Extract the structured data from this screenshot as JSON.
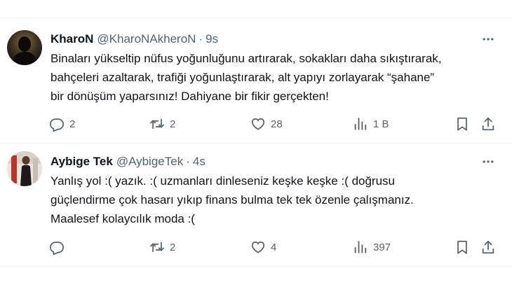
{
  "tweets": [
    {
      "author": {
        "name": "KharoN",
        "handle": "@KharoNAkheroN",
        "avatar": "dark-silhouette-avatar"
      },
      "separator": "·",
      "time": "9s",
      "text_lines": [
        "Binaları yükseltip nüfus yoğunluğunu artırarak, sokakları daha sıkıştırarak,",
        "bahçeleri azaltarak, trafiği yoğunlaştırarak, alt yapıyı zorlayarak “şahane”",
        "bir dönüşüm yaparsınız! Dahiyane bir fikir gerçekten!"
      ],
      "actions": {
        "replies": "2",
        "retweets": "2",
        "likes": "28",
        "views": "1 B"
      }
    },
    {
      "author": {
        "name": "Aybige Tek",
        "handle": "@AybigeTek",
        "avatar": "photo-avatar"
      },
      "separator": "·",
      "time": "4s",
      "text_lines": [
        "Yanlış yol :( yazık. :( uzmanları dinleseniz keşke keşke :( doğrusu",
        "güçlendirme çok hasarı yıkıp finans bulma tek tek özenle çalışmanız.",
        "Maalesef kolaycılık moda :("
      ],
      "actions": {
        "replies": "",
        "retweets": "2",
        "likes": "4",
        "views": "397"
      }
    }
  ],
  "icons": {
    "reply": "reply-icon",
    "retweet": "retweet-icon",
    "like": "heart-icon",
    "views": "views-icon",
    "bookmark": "bookmark-icon",
    "share": "share-icon",
    "more": "more-icon"
  },
  "colors": {
    "text": "#0f1419",
    "secondary": "#536471",
    "divider": "#eff3f4",
    "background": "#ffffff"
  }
}
